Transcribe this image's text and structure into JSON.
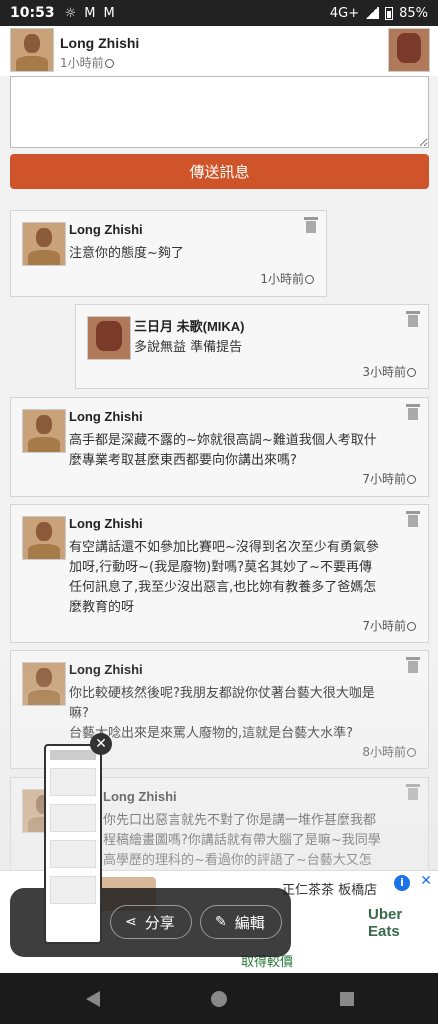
{
  "status_bar": {
    "time": "10:53",
    "network": "4G+",
    "battery": "85%"
  },
  "header": {
    "name": "Long Zhishi",
    "time": "1小時前"
  },
  "compose": {
    "placeholder": ""
  },
  "send_button": {
    "label": "傳送訊息"
  },
  "comments": [
    {
      "name": "Long Zhishi",
      "text": [
        "注意你的態度~夠了"
      ],
      "time": "1小時前"
    },
    {
      "name": "三日月 未歌(MIKA)",
      "text": [
        "多說無益 準備提告"
      ],
      "time": "3小時前"
    },
    {
      "name": "Long Zhishi",
      "text": [
        "高手都是深藏不露的~妳就很高調~難道我個人考取什",
        "麼專業考取甚麼東西都要向你講出來嗎?"
      ],
      "time": "7小時前"
    },
    {
      "name": "Long Zhishi",
      "text": [
        "有空講話還不如參加比賽吧~沒得到名次至少有勇氣參",
        "加呀,行動呀~(我是廢物)對嗎?莫名其妙了~不要再傳",
        "任何訊息了,我至少沒出惡言,也比妳有教養多了爸媽怎",
        "麼教育的呀"
      ],
      "time": "7小時前"
    },
    {
      "name": "Long Zhishi",
      "text": [
        "你比較硬核然後呢?我朋友都說你仗著台藝大很大咖是",
        "嘛?",
        "台藝大唸出來是來罵人廢物的,這就是台藝大水準?"
      ],
      "time": "8小時前"
    },
    {
      "name": "Long Zhishi",
      "text": [
        "你先口出惡言就先不對了你是講一堆作甚麼我都",
        "程稿繪畫圖嗎?你講話就有帶大腦了是嘛~我同學",
        "高學歷的理科的~看過你的評語了~台藝大又怎"
      ],
      "time": ""
    }
  ],
  "ad": {
    "title": "正仁茶茶 板橋店",
    "brand": [
      "Uber",
      "Eats"
    ],
    "cta": "取得較價"
  },
  "share_overlay": {
    "share_label": "分享",
    "edit_label": "編輯"
  },
  "colors": {
    "accent": "#d0542a"
  }
}
